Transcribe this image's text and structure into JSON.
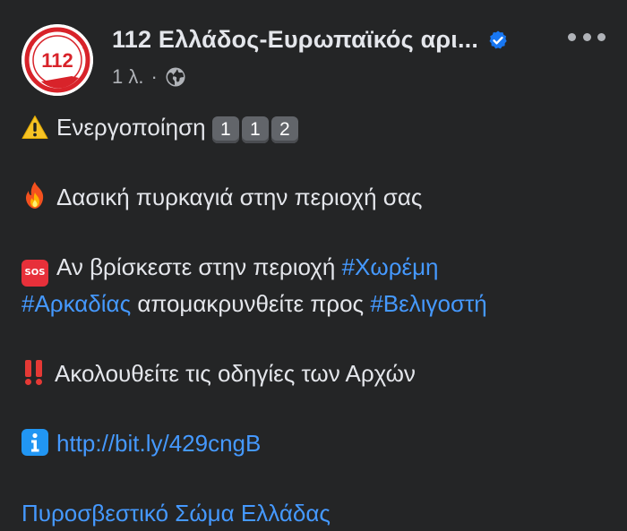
{
  "header": {
    "page_name": "112 Ελλάδος-Ευρωπαϊκός αρι...",
    "timestamp": "1 λ.",
    "separator": "·",
    "avatar_text": "112",
    "verified_icon": "verified-badge-icon",
    "privacy_icon": "globe-icon",
    "more_icon": "more-options-icon"
  },
  "post": {
    "line1": {
      "emoji": "warning-icon",
      "text": "Ενεργοποίηση",
      "keycaps": [
        "1",
        "1",
        "2"
      ]
    },
    "line2": {
      "emoji": "fire-icon",
      "text": "Δασική πυρκαγιά στην περιοχή σας"
    },
    "line3": {
      "emoji": "sos-icon",
      "sos_label": "SOS",
      "text_a": "Αν βρίσκεστε στην περιοχή",
      "hashtag_1": "#Χωρέμη",
      "hashtag_2": "#Αρκαδίας",
      "text_b": "απομακρυνθείτε προς",
      "hashtag_3": "#Βελιγοστή"
    },
    "line4": {
      "emoji": "double-exclamation-icon",
      "text": "Ακολουθείτε τις οδηγίες των Αρχών"
    },
    "line5": {
      "emoji": "info-icon",
      "link": "http://bit.ly/429cngB"
    },
    "line6": {
      "link": "Πυροσβεστικό Σώμα Ελλάδας"
    }
  },
  "colors": {
    "background": "#242526",
    "text": "#e4e6eb",
    "secondary": "#b0b3b8",
    "link": "#4599ff",
    "verified": "#1877f2",
    "logo_red": "#d8232a"
  }
}
